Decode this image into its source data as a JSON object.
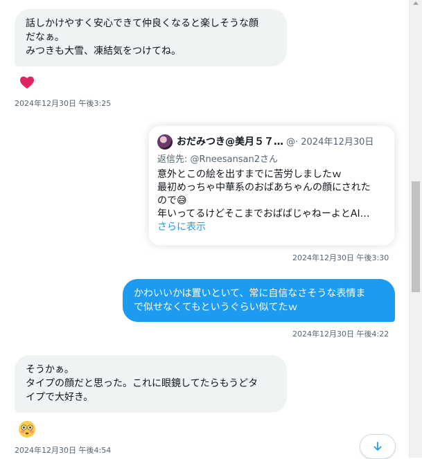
{
  "messages": [
    {
      "lines": [
        "話しかけやすく安心できて仲良くなると楽しそうな顔",
        "だなぁ。",
        "みつきも大雪、凍結気をつけてね。"
      ],
      "reaction": "❤",
      "timestamp": "2024年12月30日 午後3:25"
    },
    {
      "quote": {
        "name": "おだみつき@美月５７…",
        "handle": "@",
        "date": "· 2024年12月30日",
        "reply_to": "返信先: @Rneesansan2さん",
        "body_lines": [
          "意外とこの絵を出すまでに苦労しましたｗ",
          "最初めっちゃ中華系のおばあちゃんの顔にされた",
          "ので😅",
          "年いってるけどそこまでおばばじゃねーよとAI…"
        ],
        "show_more": "さらに表示"
      },
      "timestamp": "2024年12月30日 午後3:30"
    },
    {
      "lines": [
        "かわいいかは置いといて、常に自信なさそうな表情ま",
        "で似せなくてもというぐらい似てたｗ"
      ],
      "timestamp": "2024年12月30日 午後4:22"
    },
    {
      "lines": [
        "そうかぁ。",
        "タイプの顔だと思った。これに眼鏡してたらもうどタ",
        "イプで大好き。"
      ],
      "reaction": "😳",
      "timestamp": "2024年12月30日 午後4:54"
    }
  ],
  "colors": {
    "incoming_bubble": "#eff3f4",
    "outgoing_bubble": "#1d9bf0",
    "heart": "#f4212e",
    "timestamp": "#536471",
    "link": "#1d9bf0"
  },
  "icons": {
    "scroll_down": "arrow-down-icon",
    "reaction_heart": "heart-icon",
    "reaction_flushed": "flushed-face-icon"
  }
}
